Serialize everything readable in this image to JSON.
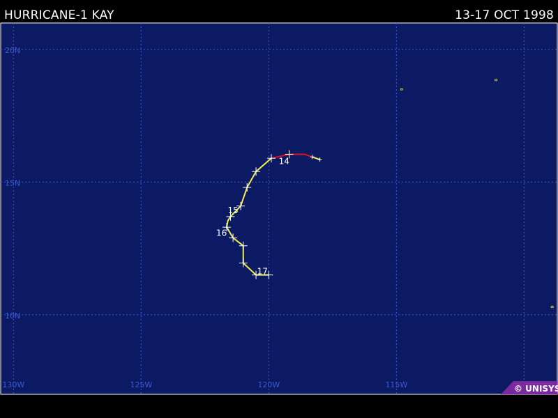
{
  "header": {
    "title": "HURRICANE-1 KAY",
    "dates": "13-17 OCT 1998"
  },
  "credit": "© UNISYS",
  "colors": {
    "ocean": "#0c1a63",
    "grid": "#3d5ad6",
    "grid_label": "#3d5ad6",
    "track_hurricane": "#e0141e",
    "track_storm": "#f2f24d",
    "marker": "#ffffff",
    "day_label": "#ffffff",
    "land": "#e8e842",
    "credit_bg": "#7a2aa0",
    "credit_text": "#ffffff"
  },
  "map": {
    "lon_min": -130.5,
    "lon_max": -108.7,
    "lat_min": 7,
    "lat_max": 21
  },
  "grid": {
    "lat_lines": [
      {
        "value": 20,
        "label": "20N"
      },
      {
        "value": 15,
        "label": "15N"
      },
      {
        "value": 10,
        "label": "10N"
      }
    ],
    "lon_lines": [
      {
        "value": -130,
        "label": "130W"
      },
      {
        "value": -125,
        "label": "125W"
      },
      {
        "value": -120,
        "label": "120W"
      },
      {
        "value": -115,
        "label": "115W"
      },
      {
        "value": -110,
        "label": ""
      }
    ]
  },
  "track": [
    {
      "lon": -118.0,
      "lat": 15.85,
      "stage": "storm"
    },
    {
      "lon": -118.3,
      "lat": 15.95,
      "stage": "storm"
    },
    {
      "lon": -118.6,
      "lat": 16.05,
      "stage": "hurricane"
    },
    {
      "lon": -119.2,
      "lat": 16.05,
      "stage": "hurricane"
    },
    {
      "lon": -119.9,
      "lat": 15.9,
      "stage": "hurricane"
    },
    {
      "lon": -120.5,
      "lat": 15.4,
      "stage": "storm"
    },
    {
      "lon": -120.85,
      "lat": 14.8,
      "stage": "storm"
    },
    {
      "lon": -121.1,
      "lat": 14.1,
      "stage": "storm"
    },
    {
      "lon": -121.5,
      "lat": 13.7,
      "stage": "storm"
    },
    {
      "lon": -121.6,
      "lat": 13.55,
      "stage": "storm"
    },
    {
      "lon": -121.65,
      "lat": 13.3,
      "stage": "storm"
    },
    {
      "lon": -121.4,
      "lat": 12.9,
      "stage": "storm"
    },
    {
      "lon": -121.0,
      "lat": 12.6,
      "stage": "storm"
    },
    {
      "lon": -121.0,
      "lat": 11.95,
      "stage": "storm"
    },
    {
      "lon": -120.5,
      "lat": 11.5,
      "stage": "storm"
    },
    {
      "lon": -120.0,
      "lat": 11.5,
      "stage": "storm"
    }
  ],
  "markers": [
    {
      "lon": -118.0,
      "lat": 15.85,
      "size": "small"
    },
    {
      "lon": -118.3,
      "lat": 15.95,
      "size": "small"
    },
    {
      "lon": -119.2,
      "lat": 16.05,
      "size": "large"
    },
    {
      "lon": -119.9,
      "lat": 15.9,
      "size": "large"
    },
    {
      "lon": -120.5,
      "lat": 15.4,
      "size": "large"
    },
    {
      "lon": -120.85,
      "lat": 14.8,
      "size": "large"
    },
    {
      "lon": -121.1,
      "lat": 14.1,
      "size": "large"
    },
    {
      "lon": -121.5,
      "lat": 13.7,
      "size": "large"
    },
    {
      "lon": -121.65,
      "lat": 13.3,
      "size": "large"
    },
    {
      "lon": -121.4,
      "lat": 12.9,
      "size": "large"
    },
    {
      "lon": -121.0,
      "lat": 12.6,
      "size": "large"
    },
    {
      "lon": -121.0,
      "lat": 11.95,
      "size": "large"
    },
    {
      "lon": -120.5,
      "lat": 11.5,
      "size": "large"
    },
    {
      "lon": -120.0,
      "lat": 11.5,
      "size": "large"
    }
  ],
  "day_labels": [
    {
      "text": "14",
      "lon": -119.4,
      "lat": 15.65
    },
    {
      "text": "15",
      "lon": -121.4,
      "lat": 13.8
    },
    {
      "text": "16",
      "lon": -121.85,
      "lat": 12.95
    },
    {
      "text": "17",
      "lon": -120.25,
      "lat": 11.5
    }
  ],
  "islands": [
    {
      "lon": -114.8,
      "lat": 18.5
    },
    {
      "lon": -111.1,
      "lat": 18.85
    },
    {
      "lon": -108.9,
      "lat": 10.3
    }
  ]
}
